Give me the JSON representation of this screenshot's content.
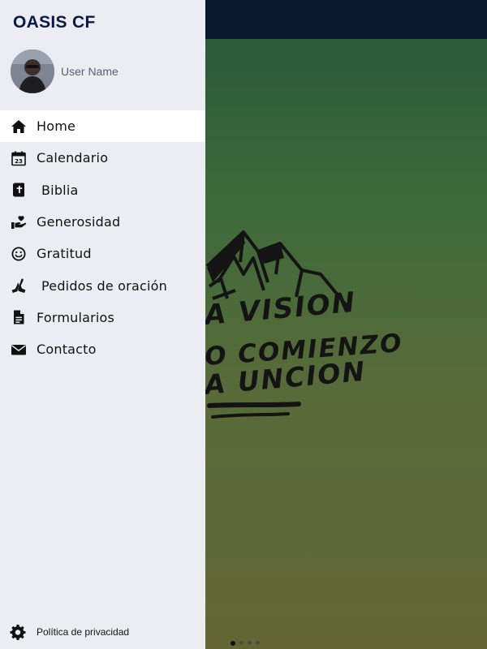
{
  "drawer": {
    "app_title": "OASIS CF",
    "user": {
      "name": "User Name"
    },
    "menu": [
      {
        "label": "Home",
        "icon": "home-icon",
        "active": true
      },
      {
        "label": "Calendario",
        "icon": "calendar-icon",
        "badge_text": "23"
      },
      {
        "label": "Biblia",
        "icon": "bible-icon"
      },
      {
        "label": "Generosidad",
        "icon": "giving-hand-icon"
      },
      {
        "label": "Gratitud",
        "icon": "smiley-icon"
      },
      {
        "label": "Pedidos de oración",
        "icon": "praying-hands-icon"
      },
      {
        "label": "Formularios",
        "icon": "document-icon"
      },
      {
        "label": "Contacto",
        "icon": "envelope-icon"
      }
    ],
    "footer": {
      "label": "Política de privacidad",
      "icon": "gear-icon"
    }
  },
  "hero": {
    "lines": [
      "A VISION",
      "O COMIENZO",
      "A UNCION"
    ]
  },
  "pager": {
    "count": 4,
    "active": 1
  },
  "colors": {
    "drawer_bg": "#ebedf3",
    "active_item_bg": "#ffffff",
    "title_color": "#0b1a45",
    "topbar": "#0a1830"
  }
}
